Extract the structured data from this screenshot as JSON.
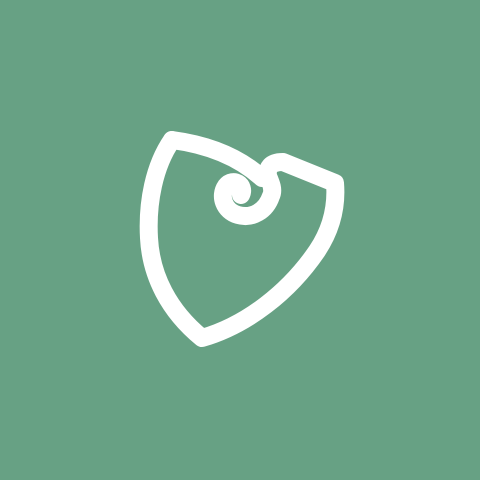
{
  "colors": {
    "background": "#67a184",
    "logo": "#ffffff"
  },
  "logo": {
    "icon": "spiral-shield-icon"
  }
}
